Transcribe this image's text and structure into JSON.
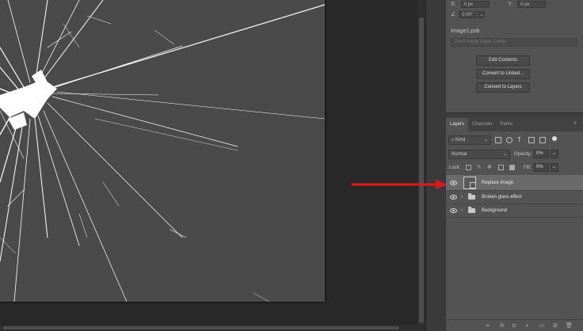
{
  "properties": {
    "x_label": "X:",
    "x_value": "0 px",
    "y_label": "Y:",
    "y_value": "0 px",
    "angle_value": "0.00°",
    "file_name": "Image1.psb",
    "layer_comp_placeholder": "Don't Apply Layer Comp",
    "buttons": [
      "Edit Contents",
      "Convert to Linked...",
      "Convert to Layers"
    ]
  },
  "layers_panel": {
    "tabs": [
      "Layers",
      "Channels",
      "Paths"
    ],
    "active_tab": "Layers",
    "filter_kind": "Kind",
    "blend_mode": "Normal",
    "opacity_label": "Opacity:",
    "opacity_value": "0%",
    "lock_label": "Lock:",
    "fill_label": "Fill:",
    "fill_value": "0%",
    "layers": [
      {
        "name": "Replace image",
        "type": "smart-object",
        "visible": true,
        "selected": true
      },
      {
        "name": "Broken glass effect",
        "type": "group",
        "visible": true,
        "selected": false
      },
      {
        "name": "Background",
        "type": "group",
        "visible": true,
        "selected": false
      }
    ]
  },
  "annotation": {
    "arrow_color": "#e0181b",
    "points_to": "Replace image"
  },
  "colors": {
    "canvas": "#4a4a4a",
    "panel": "#535353",
    "workspace": "#282828"
  }
}
